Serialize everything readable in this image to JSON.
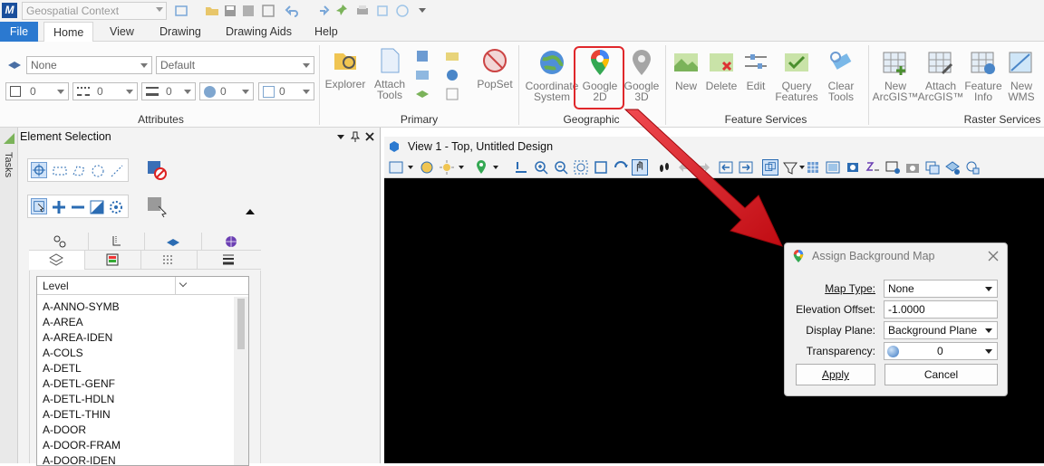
{
  "qat": {
    "workflow": "Geospatial Context"
  },
  "tabs": [
    {
      "label": "File"
    },
    {
      "label": "Home"
    },
    {
      "label": "View"
    },
    {
      "label": "Drawing"
    },
    {
      "label": "Drawing Aids"
    },
    {
      "label": "Help"
    }
  ],
  "attributes": {
    "level": "None",
    "style": "Default",
    "color": "0",
    "line_style": "0",
    "weight": "0",
    "transparency": "0",
    "priority": "0",
    "title": "Attributes"
  },
  "primary": {
    "explorer": "Explorer",
    "attach_tools": [
      "Attach",
      "Tools"
    ],
    "popset": "PopSet",
    "title": "Primary"
  },
  "geographic": {
    "coordinate_system": [
      "Coordinate",
      "System"
    ],
    "google_2d": [
      "Google",
      "2D"
    ],
    "google_3d": [
      "Google",
      "3D"
    ],
    "title": "Geographic"
  },
  "feature_services": {
    "new": "New",
    "delete": "Delete",
    "edit": "Edit",
    "query_features": [
      "Query",
      "Features"
    ],
    "clear_tools": [
      "Clear",
      "Tools"
    ],
    "title": "Feature Services"
  },
  "raster_services": {
    "new_arcgis": [
      "New",
      "ArcGIS™"
    ],
    "attach_arcgis": [
      "Attach",
      "ArcGIS™"
    ],
    "feature_info": [
      "Feature",
      "Info"
    ],
    "new_wms": [
      "New",
      "WMS"
    ],
    "title": "Raster Services"
  },
  "left_panel": {
    "tasks_label": "Tasks",
    "title": "Element Selection",
    "level_header": "Level",
    "levels": [
      "A-ANNO-SYMB",
      "A-AREA",
      "A-AREA-IDEN",
      "A-COLS",
      "A-DETL",
      "A-DETL-GENF",
      "A-DETL-HDLN",
      "A-DETL-THIN",
      "A-DOOR",
      "A-DOOR-FRAM",
      "A-DOOR-IDEN"
    ]
  },
  "view": {
    "title": "View 1 - Top, Untitled Design"
  },
  "dialog": {
    "title": "Assign Background Map",
    "map_type_label": "Map Type:",
    "map_type_value": "None",
    "elevation_label": "Elevation Offset:",
    "elevation_value": "-1.0000",
    "display_plane_label": "Display Plane:",
    "display_plane_value": "Background Plane",
    "transparency_label": "Transparency:",
    "transparency_value": "0",
    "apply": "Apply",
    "cancel": "Cancel"
  },
  "colors": {
    "accent": "#2b79d0",
    "highlight": "#e0272b",
    "arrow": "#d9151b",
    "canvas": "#000000"
  }
}
